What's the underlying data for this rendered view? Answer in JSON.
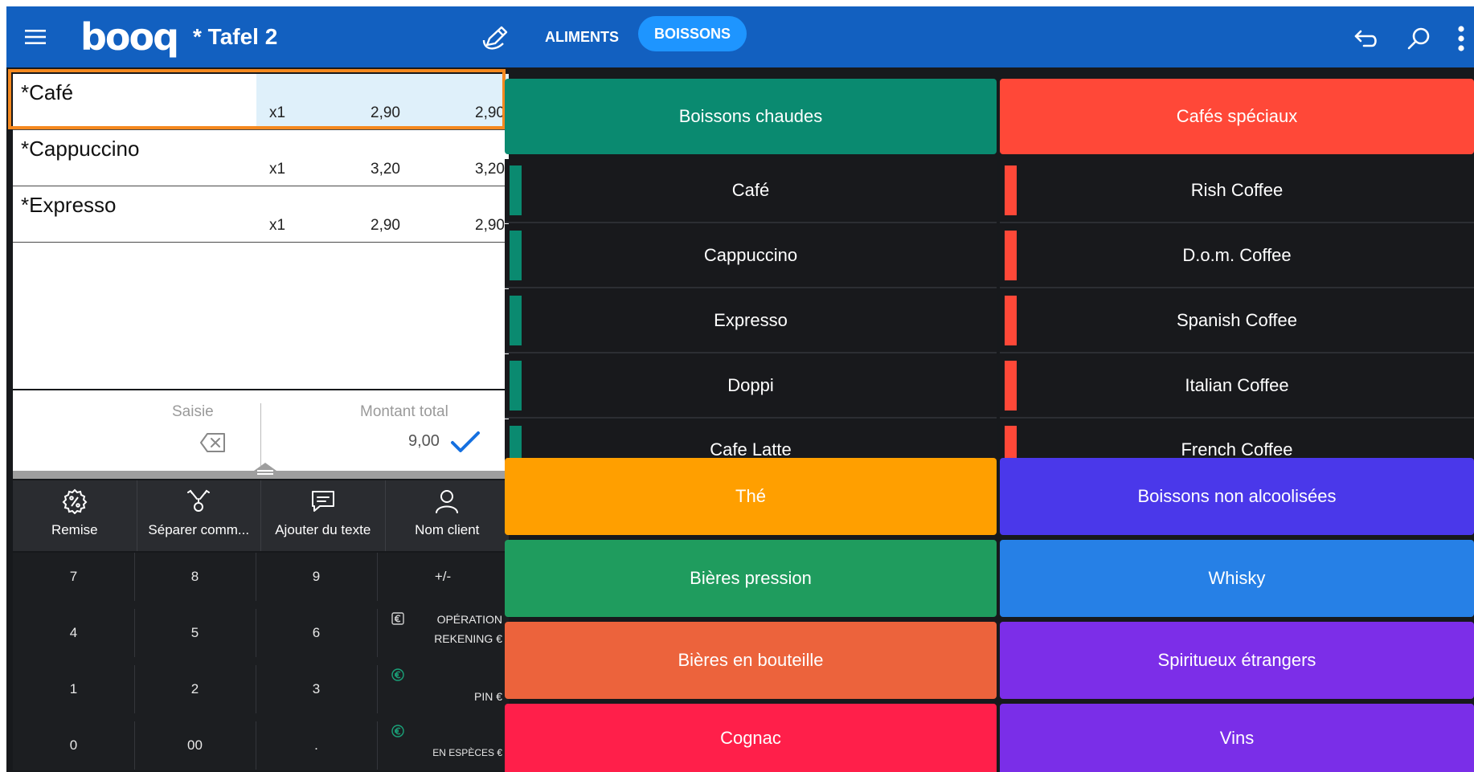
{
  "header": {
    "logo_text": "booq",
    "table_title": "* Tafel 2",
    "tabs": [
      {
        "label": "ALIMENTS",
        "active": false
      },
      {
        "label": "BOISSONS",
        "active": true
      }
    ]
  },
  "order": {
    "items": [
      {
        "name": "*Café",
        "qty": "x1",
        "price": "2,90",
        "total": "2,90",
        "selected": true
      },
      {
        "name": "*Cappuccino",
        "qty": "x1",
        "price": "3,20",
        "total": "3,20",
        "selected": false
      },
      {
        "name": "*Expresso",
        "qty": "x1",
        "price": "2,90",
        "total": "2,90",
        "selected": false
      }
    ],
    "saisie_label": "Saisie",
    "montant_label": "Montant total",
    "montant_value": "9,00"
  },
  "actions": [
    {
      "label": "Remise",
      "icon": "percent-icon"
    },
    {
      "label": "Séparer comm...",
      "icon": "split-icon"
    },
    {
      "label": "Ajouter du texte",
      "icon": "text-message-icon"
    },
    {
      "label": "Nom client",
      "icon": "person-icon"
    }
  ],
  "keypad": {
    "rows": [
      [
        "7",
        "8",
        "9",
        "+/-"
      ],
      [
        "4",
        "5",
        "6"
      ],
      [
        "1",
        "2",
        "3"
      ],
      [
        "0",
        "00",
        "."
      ]
    ],
    "payments": [
      {
        "label_line1": "OPÉRATION",
        "label_line2": "REKENING €",
        "icon": "rekening-icon"
      },
      {
        "label_line1": "",
        "label_line2": "PIN €",
        "icon": "euro-coin-icon"
      },
      {
        "label_line1": "",
        "label_line2": "EN ESPÈCES €",
        "icon": "euro-coin-icon"
      }
    ]
  },
  "categories": {
    "boissons_chaudes": {
      "label": "Boissons chaudes",
      "color": "#0a8a70"
    },
    "cafes_speciaux": {
      "label": "Cafés spéciaux",
      "color": "#ff4838"
    },
    "hot_items": [
      "Café",
      "Cappuccino",
      "Expresso",
      "Doppi",
      "Cafe Latte"
    ],
    "special_items": [
      "Rish Coffee",
      "D.o.m. Coffee",
      "Spanish Coffee",
      "Italian Coffee",
      "French Coffee"
    ],
    "grid": [
      {
        "label": "Thé",
        "color": "#ff9f00"
      },
      {
        "label": "Boissons non alcoolisées",
        "color": "#4a38ea"
      },
      {
        "label": "Bières pression",
        "color": "#1f9c5e"
      },
      {
        "label": "Whisky",
        "color": "#2680e6"
      },
      {
        "label": "Bières en bouteille",
        "color": "#ec633c"
      },
      {
        "label": "Spiritueux étrangers",
        "color": "#7c2ee8"
      },
      {
        "label": "Cognac",
        "color": "#ff1f4a"
      },
      {
        "label": "Vins",
        "color": "#7a2ee8"
      }
    ]
  },
  "colors": {
    "topbar": "#1260c0",
    "active_tab": "#1e95ff",
    "selection_frame": "#f5891f",
    "check": "#1570e0"
  }
}
